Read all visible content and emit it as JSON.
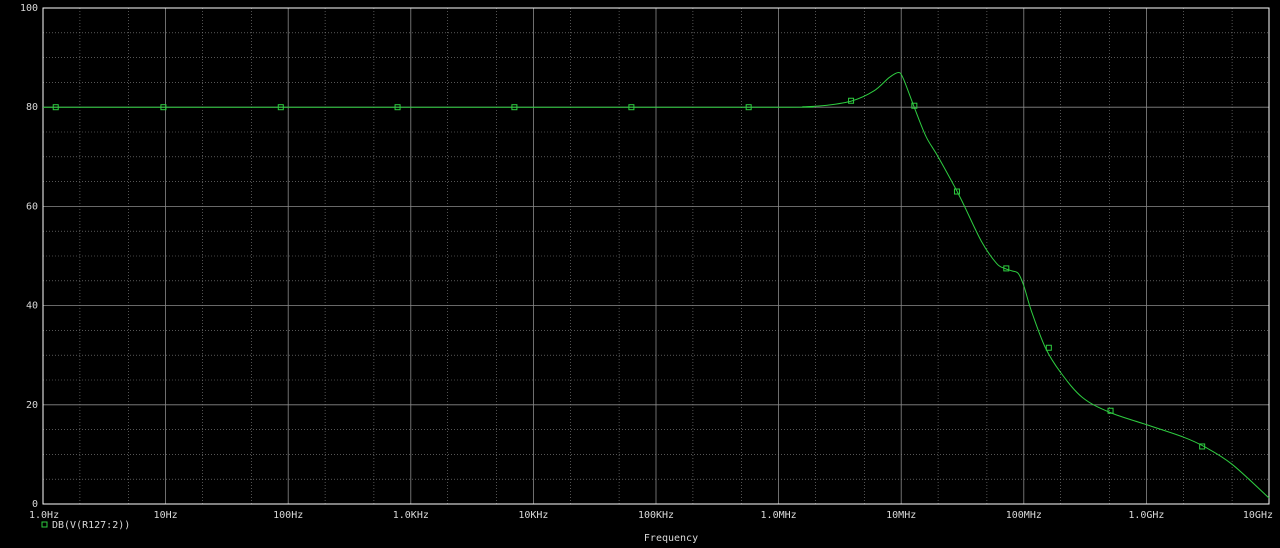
{
  "chart_data": {
    "type": "line",
    "x_scale": "log",
    "xlabel": "Frequency",
    "ylabel": "",
    "xlim": [
      1,
      10000000000
    ],
    "ylim": [
      0,
      100
    ],
    "grid": true,
    "background": "#000000",
    "grid_color": "#8a8a8a",
    "axis_color": "#ffffff",
    "text_color": "#d8d8d8",
    "x_ticks": [
      {
        "value": 1,
        "label": "1.0Hz"
      },
      {
        "value": 10,
        "label": "10Hz"
      },
      {
        "value": 100,
        "label": "100Hz"
      },
      {
        "value": 1000,
        "label": "1.0KHz"
      },
      {
        "value": 10000,
        "label": "10KHz"
      },
      {
        "value": 100000,
        "label": "100KHz"
      },
      {
        "value": 1000000,
        "label": "1.0MHz"
      },
      {
        "value": 10000000,
        "label": "10MHz"
      },
      {
        "value": 100000000,
        "label": "100MHz"
      },
      {
        "value": 1000000000,
        "label": "1.0GHz"
      },
      {
        "value": 10000000000,
        "label": "10GHz"
      }
    ],
    "y_ticks": [
      {
        "value": 0,
        "label": "0"
      },
      {
        "value": 20,
        "label": "20"
      },
      {
        "value": 40,
        "label": "40"
      },
      {
        "value": 60,
        "label": "60"
      },
      {
        "value": 80,
        "label": "80"
      },
      {
        "value": 100,
        "label": "100"
      }
    ],
    "series": [
      {
        "name": "DB(V(R127:2))",
        "color": "#2ecc40",
        "marker": "square",
        "x": [
          1,
          1000,
          1000000,
          1600000,
          2500000,
          4000000,
          6000000,
          8000000,
          9500000,
          10300000,
          11500000,
          13000000,
          16000000,
          20000000,
          30000000,
          45000000,
          60000000,
          70000000,
          80000000,
          90000000,
          100000000,
          115000000,
          150000000,
          200000000,
          300000000,
          500000000,
          1000000000,
          2000000000,
          3000000000,
          5000000000,
          10000000000
        ],
        "y": [
          80,
          80,
          80,
          80.1,
          80.4,
          81.3,
          83.3,
          86,
          87,
          86,
          83,
          79.5,
          74,
          70,
          62,
          53,
          48.5,
          47.5,
          47,
          46.5,
          44,
          39,
          31.5,
          26.5,
          21.5,
          18.5,
          16,
          13.5,
          11.5,
          8,
          1.2
        ],
        "markers_x": [
          1.27,
          9.6,
          87,
          780,
          7000,
          63000,
          570000,
          3900000,
          12800000,
          28500000,
          72000000,
          160000000,
          510000000,
          2850000000
        ],
        "markers_y": [
          80,
          80,
          80,
          80,
          80,
          80,
          80,
          81.3,
          80.3,
          63,
          47.5,
          31.5,
          18.8,
          11.6
        ]
      }
    ]
  }
}
